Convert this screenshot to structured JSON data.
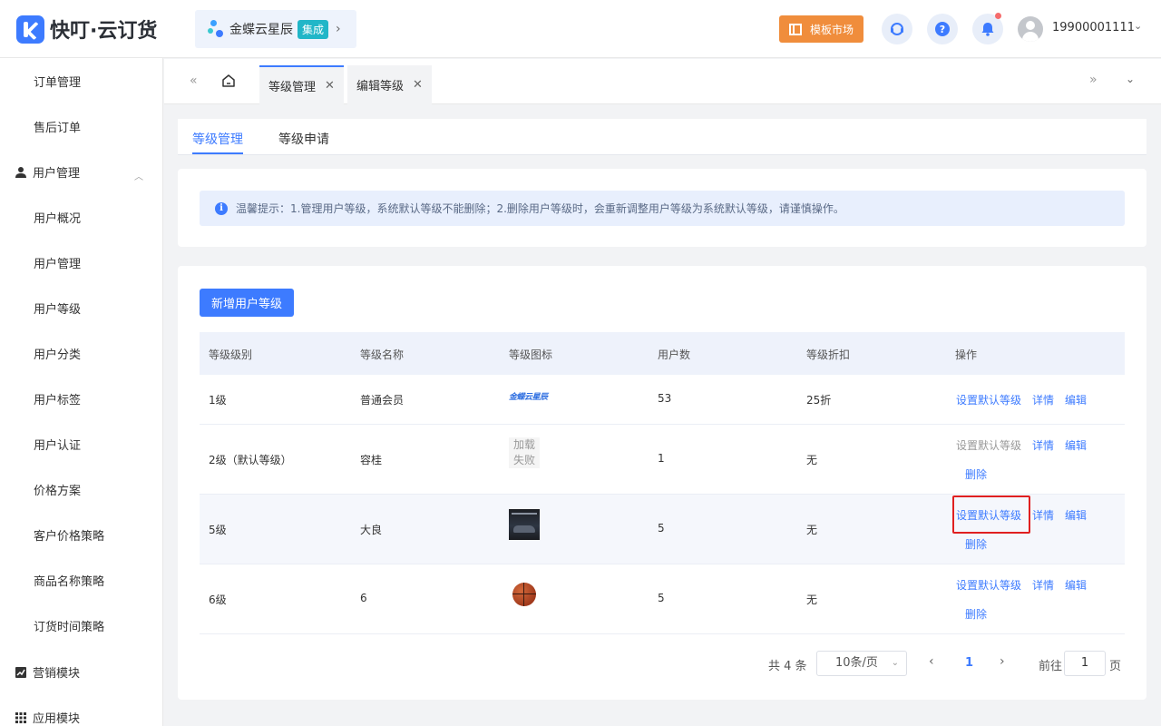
{
  "header": {
    "app_name": "快叮·云订货",
    "brand_name": "金蝶云星辰",
    "brand_badge": "集成",
    "market_label": "模板市场",
    "username": "19900001111"
  },
  "sidebar": {
    "items": [
      {
        "label": "订单管理"
      },
      {
        "label": "售后订单"
      },
      {
        "label": "用户管理",
        "group": true
      },
      {
        "label": "用户概况"
      },
      {
        "label": "用户管理"
      },
      {
        "label": "用户等级"
      },
      {
        "label": "用户分类"
      },
      {
        "label": "用户标签"
      },
      {
        "label": "用户认证"
      },
      {
        "label": "价格方案"
      },
      {
        "label": "客户价格策略"
      },
      {
        "label": "商品名称策略"
      },
      {
        "label": "订货时间策略"
      },
      {
        "label": "营销模块",
        "group": true
      },
      {
        "label": "应用模块",
        "group": true
      }
    ]
  },
  "tabs": [
    {
      "label": "等级管理",
      "active": true
    },
    {
      "label": "编辑等级",
      "active": false
    }
  ],
  "subtabs": [
    {
      "label": "等级管理",
      "active": true
    },
    {
      "label": "等级申请",
      "active": false
    }
  ],
  "notice": "温馨提示：1.管理用户等级，系统默认等级不能删除；2.删除用户等级时，会重新调整用户等级为系统默认等级，请谨慎操作。",
  "toolbar": {
    "add_label": "新增用户等级"
  },
  "table": {
    "headers": [
      "等级级别",
      "等级名称",
      "等级图标",
      "用户数",
      "等级折扣",
      "操作"
    ],
    "rows": [
      {
        "level": "1级",
        "name": "普通会员",
        "icon": "jd-logo-icon",
        "icon_text": "金蝶云星辰",
        "users": "53",
        "discount": "25折",
        "ops": [
          "设置默认等级",
          "详情",
          "编辑"
        ]
      },
      {
        "level": "2级（默认等级）",
        "name": "容桂",
        "icon": "load-failed",
        "icon_text": "加载失败",
        "users": "1",
        "discount": "无",
        "ops": [
          "设置默认等级",
          "详情",
          "编辑",
          "删除"
        ]
      },
      {
        "level": "5级",
        "name": "大良",
        "icon": "car-image-icon",
        "users": "5",
        "discount": "无",
        "ops": [
          "设置默认等级",
          "详情",
          "编辑",
          "删除"
        ]
      },
      {
        "level": "6级",
        "name": "6",
        "icon": "basketball-image-icon",
        "users": "5",
        "discount": "无",
        "ops": [
          "设置默认等级",
          "详情",
          "编辑",
          "删除"
        ]
      }
    ]
  },
  "pagination": {
    "total": "共 4 条",
    "page_size": "10条/页",
    "current": "1",
    "goto_label": "前往",
    "goto_value": "1",
    "page_suffix": "页"
  },
  "colors": {
    "primary": "#3d7bff",
    "market": "#f08d3c",
    "highlight": "#e02020"
  }
}
